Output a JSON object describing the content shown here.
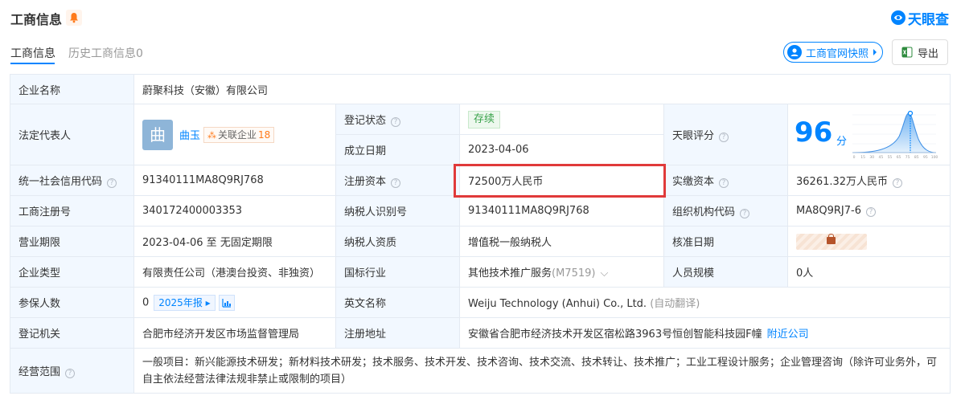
{
  "header": {
    "title": "工商信息",
    "logo_text": "天眼查",
    "brand_color": "#0084ff"
  },
  "tabs": [
    {
      "label": "工商信息",
      "active": true
    },
    {
      "label": "历史工商信息0",
      "active": false
    }
  ],
  "toolbar": {
    "official_site_label": "工商官网快照",
    "export_label": "导出"
  },
  "rows": {
    "company_name": {
      "label": "企业名称",
      "value": "蔚聚科技（安徽）有限公司"
    },
    "legal_rep": {
      "label": "法定代表人",
      "avatar_char": "曲",
      "name": "曲玉",
      "related_label": "关联企业",
      "related_count": "18"
    },
    "reg_status": {
      "label": "登记状态",
      "value": "存续"
    },
    "found_date": {
      "label": "成立日期",
      "value": "2023-04-06"
    },
    "score": {
      "label": "天眼评分",
      "value": "96",
      "unit": "分",
      "axis_ticks": [
        "0",
        "15",
        "30",
        "45",
        "55",
        "65",
        "75",
        "85",
        "95",
        "100"
      ]
    },
    "credit_code": {
      "label": "统一社会信用代码",
      "value": "91340111MA8Q9RJ768"
    },
    "reg_capital": {
      "label": "注册资本",
      "value": "72500万人民币"
    },
    "paid_capital": {
      "label": "实缴资本",
      "value": "36261.32万人民币"
    },
    "reg_no": {
      "label": "工商注册号",
      "value": "340172400003353"
    },
    "taxpayer_id": {
      "label": "纳税人识别号",
      "value": "91340111MA8Q9RJ768"
    },
    "org_code": {
      "label": "组织机构代码",
      "value": "MA8Q9RJ7-6"
    },
    "term": {
      "label": "营业期限",
      "value": "2023-04-06 至 无固定期限"
    },
    "taxpayer_qual": {
      "label": "纳税人资质",
      "value": "增值税一般纳税人"
    },
    "approve_date": {
      "label": "核准日期"
    },
    "company_type": {
      "label": "企业类型",
      "value": "有限责任公司（港澳台投资、非独资）"
    },
    "industry": {
      "label": "国标行业",
      "value": "其他技术推广服务",
      "code": "(M7519)"
    },
    "staff_size": {
      "label": "人员规模",
      "value": "0人"
    },
    "insured": {
      "label": "参保人数",
      "value": "0",
      "year_label": "2025年报"
    },
    "english_name": {
      "label": "英文名称",
      "value": "Weiju Technology (Anhui) Co., Ltd.",
      "note": "(自动翻译)"
    },
    "authority": {
      "label": "登记机关",
      "value": "合肥市经济开发区市场监督管理局"
    },
    "address": {
      "label": "注册地址",
      "value": "安徽省合肥市经济技术开发区宿松路3963号恒创智能科技园F幢",
      "link": "附近公司"
    },
    "scope": {
      "label": "经营范围",
      "value": "一般项目：新兴能源技术研发；新材料技术研发；技术服务、技术开发、技术咨询、技术交流、技术转让、技术推广；工业工程设计服务；企业管理咨询（除许可业务外，可自主依法经营法律法规非禁止或限制的项目）"
    }
  }
}
